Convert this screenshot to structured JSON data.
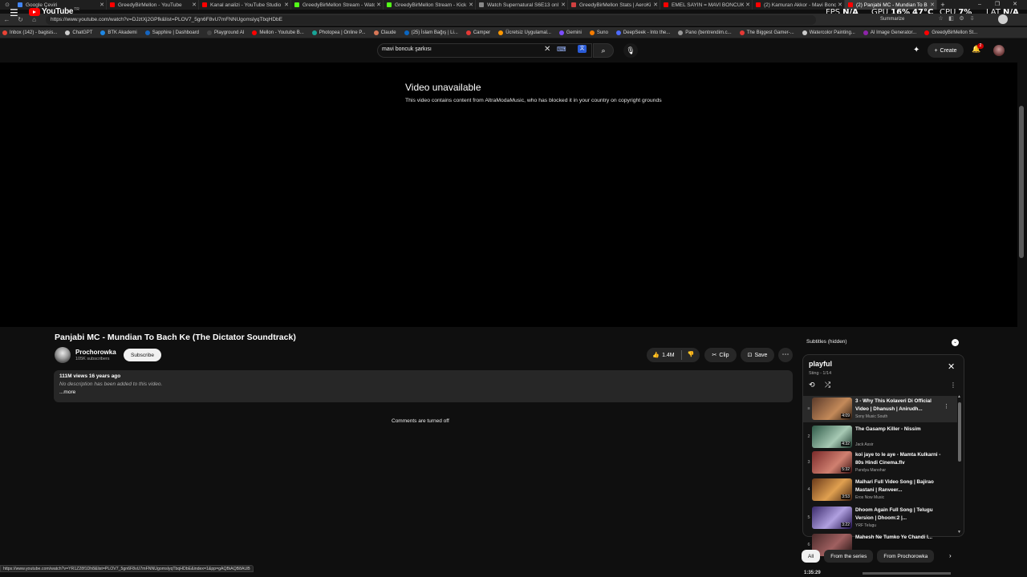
{
  "browser": {
    "tabs": [
      {
        "label": "Google Çeviri",
        "color": "#4285f4"
      },
      {
        "label": "GreedyBirMellon - YouTube",
        "color": "#ff0000"
      },
      {
        "label": "Kanal analizi - YouTube Studio",
        "color": "#ff0000"
      },
      {
        "label": "GreedyBirMellon Stream - Watc",
        "color": "#53fc18"
      },
      {
        "label": "GreedyBirMellon Stream - Kick",
        "color": "#53fc18"
      },
      {
        "label": "Watch Supernatural S6E13 onl",
        "color": "#888888"
      },
      {
        "label": "GreedyBirMellon Stats | AeroKi",
        "color": "#d04040"
      },
      {
        "label": "EMEL SAYIN = MAVİ BONCUK",
        "color": "#ff0000"
      },
      {
        "label": "(2) Kamuran Akkor - Mavi Bonc",
        "color": "#ff0000"
      },
      {
        "label": "(2) Panjabi MC - Mundian To B",
        "color": "#ff0000"
      }
    ],
    "url": "https://www.youtube.com/watch?v=DJztXj2GPfk&list=PLOV7_5gn6F8vU7mFNNUgomslyqTbqHDbE",
    "summarize": "Summarize",
    "bookmarks": [
      {
        "label": "Inbox (142) - bagisis...",
        "color": "#ea4335"
      },
      {
        "label": "ChatGPT",
        "color": "#cccccc"
      },
      {
        "label": "BTK Akademi",
        "color": "#1e88e5"
      },
      {
        "label": "Sapphire | Dashboard",
        "color": "#1565c0"
      },
      {
        "label": "Playground AI",
        "color": "#444444"
      },
      {
        "label": "Mellon - Youtube B...",
        "color": "#ff0000"
      },
      {
        "label": "Photopea | Online P...",
        "color": "#18a497"
      },
      {
        "label": "Claude",
        "color": "#d97757"
      },
      {
        "label": "(25) İslam Bağış | Li...",
        "color": "#0a66c2"
      },
      {
        "label": "Camper",
        "color": "#e53935"
      },
      {
        "label": "Ücretsiz Uygulamal...",
        "color": "#ff9800"
      },
      {
        "label": "Gemini",
        "color": "#7c4dff"
      },
      {
        "label": "Suno",
        "color": "#f57c00"
      },
      {
        "label": "DeepSeek - Into the...",
        "color": "#4d6bfe"
      },
      {
        "label": "Pano (bentrendim.c...",
        "color": "#999999"
      },
      {
        "label": "The Biggest Gamer-...",
        "color": "#e53935"
      },
      {
        "label": "Watercolor Painting...",
        "color": "#cccccc"
      },
      {
        "label": "AI Image Generator...",
        "color": "#8e24aa"
      },
      {
        "label": "GreedyBirMellon St...",
        "color": "#ff0000"
      }
    ],
    "status_url": "https://www.youtube.com/watch?v=YR1Z28f1Dh8&list=PLOV7_5gn6F8vU7mFNNUgomslyqTbqHDbE&index=1&pp=gAQBiAQB8AUB"
  },
  "overlay": {
    "fps_label": "FPS",
    "fps_value": "N/A",
    "gpu_label": "GPU",
    "gpu_value": "16%",
    "gpu_temp": "47°C",
    "cpu_label": "CPU",
    "cpu_value": "7%",
    "lat_label": "LAT",
    "lat_value": "N/A"
  },
  "masthead": {
    "logo": "YouTube",
    "logo_region": "TR",
    "search_query": "mavi boncuk şarkısı",
    "create_label": "Create",
    "notif_count": "2"
  },
  "player": {
    "unavailable_title": "Video unavailable",
    "unavailable_message": "This video contains content from AltraModaMusic, who has blocked it in your country on copyright grounds"
  },
  "video": {
    "title": "Panjabi MC - Mundian To Bach Ke (The Dictator Soundtrack)",
    "channel": "Prochorowka",
    "subscribers": "105K subscribers",
    "subscribe_label": "Subscribe",
    "likes": "1.4M",
    "clip_label": "Clip",
    "save_label": "Save",
    "views_date": "111M views  16 years ago",
    "description": "No description has been added to this video.",
    "more_label": "...more",
    "comments_off": "Comments are turned off"
  },
  "sidebar": {
    "subtitles_label": "Subtitles (hidden)",
    "playlist_title": "playful",
    "playlist_sub": "Sting - 1/14",
    "items": [
      {
        "index": "",
        "title": "3 - Why This Kolaveri Di Official Video | Dhanush | Anirudh...",
        "channel": "Sony Music South",
        "duration": "4:09"
      },
      {
        "index": "2",
        "title": "The Gasamp Killer - Nissim",
        "channel": "Jack Assir",
        "duration": "4:32"
      },
      {
        "index": "3",
        "title": "koi jaye to le aye - Mamta Kulkarni - 80s Hindi Cinema.flv",
        "channel": "Pandya Manohar",
        "duration": "5:32"
      },
      {
        "index": "4",
        "title": "Malhari Full Video Song | Bajirao Mastani | Ranveer...",
        "channel": "Eros Now Music",
        "duration": "3:53"
      },
      {
        "index": "5",
        "title": "Dhoom Again Full Song | Telugu Version | Dhoom:2 |...",
        "channel": "YRF Telugu",
        "duration": "3:22"
      },
      {
        "index": "6",
        "title": "Mahesh Ne Tumko Ye Chandi I...",
        "channel": "",
        "duration": ""
      }
    ],
    "chips": [
      "All",
      "From the series",
      "From Prochorowka"
    ],
    "bottom_text": "1:35:29"
  }
}
